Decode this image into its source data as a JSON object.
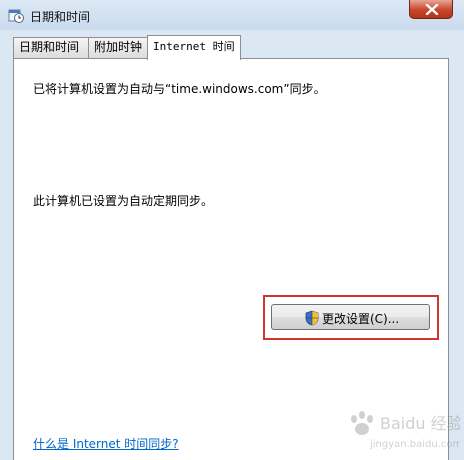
{
  "window": {
    "title": "日期和时间",
    "icon": "clock-calendar-icon",
    "close_icon": "close-icon"
  },
  "tabs": [
    {
      "label": "日期和时间",
      "active": false
    },
    {
      "label": "附加时钟",
      "active": false
    },
    {
      "label": "Internet 时间",
      "active": true
    }
  ],
  "panel": {
    "sync_message": "已将计算机设置为自动与“time.windows.com”同步。",
    "schedule_message": "此计算机已设置为自动定期同步。",
    "change_button_label": "更改设置(C)...",
    "change_button_icon": "uac-shield-icon",
    "help_link": "什么是 Internet 时间同步?"
  },
  "annotation": {
    "highlight_color": "#d2352e"
  },
  "watermark": {
    "text": "Baidu 经验",
    "subtext": "jingyan.baidu.com"
  }
}
